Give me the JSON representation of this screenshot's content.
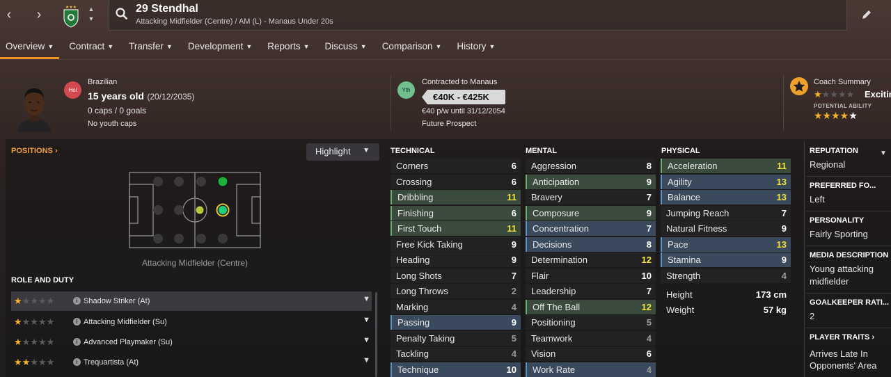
{
  "topbar": {
    "nav_back": "‹",
    "nav_forward": "›",
    "player_name": "29 Stendhal",
    "player_subtitle": "Attacking Midfielder (Centre) / AM (L) - Manaus Under 20s",
    "icons": [
      "back-arrow-icon",
      "forward-arrow-icon",
      "club-badge-icon",
      "search-icon",
      "edit-pencil-icon"
    ]
  },
  "tabs": [
    {
      "label": "Overview"
    },
    {
      "label": "Contract"
    },
    {
      "label": "Transfer"
    },
    {
      "label": "Development"
    },
    {
      "label": "Reports"
    },
    {
      "label": "Discuss"
    },
    {
      "label": "Comparison"
    },
    {
      "label": "History"
    }
  ],
  "info": {
    "nationality_badge": "Hol",
    "nationality": "Brazilian",
    "age": "15 years old",
    "dob": "(20/12/2035)",
    "caps": "0 caps / 0 goals",
    "youth_caps": "No youth caps"
  },
  "contract": {
    "badge": "Yth",
    "contracted_to": "Contracted to Manaus",
    "value": "€40K - €425K",
    "wage": "€40 p/w until 31/12/2054",
    "status": "Future Prospect"
  },
  "coach": {
    "title": "Coach Summary",
    "summary": "Exciting",
    "current_ability_stars": 0.5,
    "potential_label": "POTENTIAL ABILITY",
    "potential_ability_stars": 5
  },
  "positions": {
    "label": "POSITIONS",
    "highlight_button": "Highlight",
    "caption": "Attacking Midfielder (Centre)"
  },
  "roles": {
    "label": "ROLE AND DUTY",
    "items": [
      {
        "name": "Shadow Striker (At)",
        "stars": 0.5
      },
      {
        "name": "Attacking Midfielder (Su)",
        "stars": 0.5
      },
      {
        "name": "Advanced Playmaker (Su)",
        "stars": 0.5
      },
      {
        "name": "Trequartista (At)",
        "stars": 1
      }
    ]
  },
  "attributes": {
    "technical": {
      "title": "TECHNICAL",
      "items": [
        {
          "name": "Corners",
          "value": "6",
          "hl": "none",
          "color": "white"
        },
        {
          "name": "Crossing",
          "value": "6",
          "hl": "none",
          "color": "white"
        },
        {
          "name": "Dribbling",
          "value": "11",
          "hl": "green",
          "color": "yellow"
        },
        {
          "name": "Finishing",
          "value": "6",
          "hl": "green",
          "color": "white"
        },
        {
          "name": "First Touch",
          "value": "11",
          "hl": "green",
          "color": "yellow"
        },
        {
          "name": "Free Kick Taking",
          "value": "9",
          "hl": "none",
          "color": "white"
        },
        {
          "name": "Heading",
          "value": "9",
          "hl": "none",
          "color": "white"
        },
        {
          "name": "Long Shots",
          "value": "7",
          "hl": "none",
          "color": "white"
        },
        {
          "name": "Long Throws",
          "value": "2",
          "hl": "none",
          "color": "grey"
        },
        {
          "name": "Marking",
          "value": "4",
          "hl": "none",
          "color": "grey"
        },
        {
          "name": "Passing",
          "value": "9",
          "hl": "blue",
          "color": "white"
        },
        {
          "name": "Penalty Taking",
          "value": "5",
          "hl": "none",
          "color": "grey"
        },
        {
          "name": "Tackling",
          "value": "4",
          "hl": "none",
          "color": "grey"
        },
        {
          "name": "Technique",
          "value": "10",
          "hl": "blue",
          "color": "white"
        }
      ]
    },
    "mental": {
      "title": "MENTAL",
      "items": [
        {
          "name": "Aggression",
          "value": "8",
          "hl": "none",
          "color": "white"
        },
        {
          "name": "Anticipation",
          "value": "9",
          "hl": "green",
          "color": "white"
        },
        {
          "name": "Bravery",
          "value": "7",
          "hl": "none",
          "color": "white"
        },
        {
          "name": "Composure",
          "value": "9",
          "hl": "green",
          "color": "white"
        },
        {
          "name": "Concentration",
          "value": "7",
          "hl": "blue",
          "color": "white"
        },
        {
          "name": "Decisions",
          "value": "8",
          "hl": "blue",
          "color": "white"
        },
        {
          "name": "Determination",
          "value": "12",
          "hl": "none",
          "color": "yellow"
        },
        {
          "name": "Flair",
          "value": "10",
          "hl": "none",
          "color": "white"
        },
        {
          "name": "Leadership",
          "value": "7",
          "hl": "none",
          "color": "white"
        },
        {
          "name": "Off The Ball",
          "value": "12",
          "hl": "green",
          "color": "yellow"
        },
        {
          "name": "Positioning",
          "value": "5",
          "hl": "none",
          "color": "grey"
        },
        {
          "name": "Teamwork",
          "value": "4",
          "hl": "none",
          "color": "grey"
        },
        {
          "name": "Vision",
          "value": "6",
          "hl": "none",
          "color": "white"
        },
        {
          "name": "Work Rate",
          "value": "4",
          "hl": "blue",
          "color": "grey"
        }
      ]
    },
    "physical": {
      "title": "PHYSICAL",
      "items": [
        {
          "name": "Acceleration",
          "value": "11",
          "hl": "green",
          "color": "yellow"
        },
        {
          "name": "Agility",
          "value": "13",
          "hl": "blue",
          "color": "yellow"
        },
        {
          "name": "Balance",
          "value": "13",
          "hl": "blue",
          "color": "yellow"
        },
        {
          "name": "Jumping Reach",
          "value": "7",
          "hl": "none",
          "color": "white"
        },
        {
          "name": "Natural Fitness",
          "value": "9",
          "hl": "none",
          "color": "white"
        },
        {
          "name": "Pace",
          "value": "13",
          "hl": "blue",
          "color": "yellow"
        },
        {
          "name": "Stamina",
          "value": "9",
          "hl": "blue",
          "color": "white"
        },
        {
          "name": "Strength",
          "value": "4",
          "hl": "none",
          "color": "grey"
        }
      ],
      "height_label": "Height",
      "height_value": "173 cm",
      "weight_label": "Weight",
      "weight_value": "57 kg"
    }
  },
  "sidebar": {
    "reputation_label": "REPUTATION",
    "reputation": "Regional",
    "foot_label": "PREFERRED FO...",
    "foot": "Left",
    "personality_label": "PERSONALITY",
    "personality": "Fairly Sporting",
    "media_label": "MEDIA DESCRIPTION",
    "media_line1": "Young attacking",
    "media_line2": "midfielder",
    "gk_label": "GOALKEEPER RATI...",
    "gk_value": "2",
    "traits_label": "PLAYER TRAITS",
    "trait_line1": "Arrives Late In",
    "trait_line2": "Opponents' Area"
  },
  "colors": {
    "accent": "#e8921f",
    "green_highlight": "#3a4a3d",
    "blue_highlight": "#3a4a5c",
    "yellow_value": "#f3e33b"
  }
}
